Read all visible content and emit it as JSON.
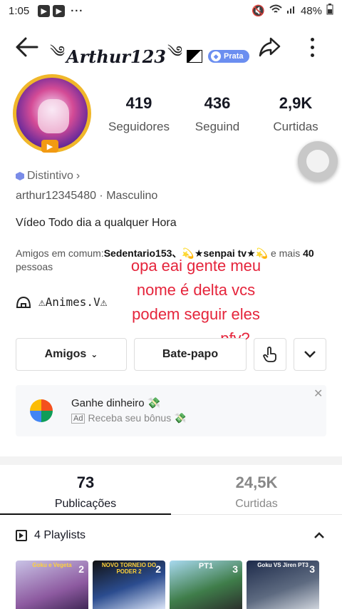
{
  "status_bar": {
    "time": "1:05",
    "dots": "···",
    "battery": "48%"
  },
  "header": {
    "username": "Arthur123",
    "ornament_left": "༄",
    "ornament_right": "༄",
    "badge": "Prata"
  },
  "stats": [
    {
      "value": "419",
      "label": "Seguidores"
    },
    {
      "value": "436",
      "label": "Seguind"
    },
    {
      "value": "2,9K",
      "label": "Curtidas"
    }
  ],
  "profile": {
    "distintivo": "Distintivo",
    "id_line": "arthur12345480 · Masculino",
    "bio": "Vídeo Todo dia a qualquer Hora",
    "friends_prefix": "Amigos em comum:",
    "friends_names": "Sedentario153、💫★senpai tv★💫",
    "friends_suffix_1": "e mais ",
    "friends_count": "40",
    "friends_suffix_2": " pessoas",
    "animes": "⚠Animes.V⚠"
  },
  "overlay_text": [
    "opa eai gente meu",
    "nome é delta vcs",
    "podem seguir eles",
    "pfv?"
  ],
  "buttons": {
    "friends": "Amigos",
    "chat": "Bate-papo"
  },
  "ad": {
    "title": "Ganhe dinheiro 💸",
    "tag": "Ad",
    "subtitle": "Receba seu bônus 💸"
  },
  "tabs": [
    {
      "value": "73",
      "label": "Publicações"
    },
    {
      "value": "24,5K",
      "label": "Curtidas"
    }
  ],
  "playlists": {
    "label": "4 Playlists"
  },
  "thumbnails": [
    {
      "count": "2",
      "caption": "Goku e Vegeta",
      "color": "#8d5aa0"
    },
    {
      "count": "2",
      "caption": "NOVO TORNEIO DO PODER 2",
      "color": "#2b4c8f"
    },
    {
      "count": "3",
      "caption": "PT1",
      "color": "#3f7d4a"
    },
    {
      "count": "3",
      "caption": "Goku VS Jiren PT3",
      "color": "#5d6a80"
    }
  ]
}
